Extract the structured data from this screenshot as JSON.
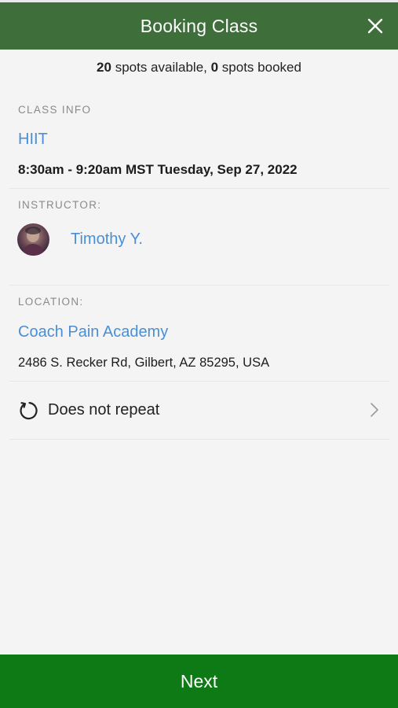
{
  "header": {
    "title": "Booking Class",
    "close_icon": "close-icon"
  },
  "spots": {
    "available_count": "20",
    "available_text": " spots available, ",
    "booked_count": "0",
    "booked_text": " spots booked"
  },
  "class_info": {
    "label": "CLASS INFO",
    "name": "HIIT",
    "time": "8:30am - 9:20am MST Tuesday, Sep 27, 2022"
  },
  "instructor": {
    "label": "INSTRUCTOR:",
    "name": "Timothy Y."
  },
  "location": {
    "label": "LOCATION:",
    "name": "Coach Pain Academy",
    "address": "2486 S. Recker Rd, Gilbert, AZ 85295, USA"
  },
  "repeat": {
    "label": "Does not repeat",
    "icon": "repeat-icon"
  },
  "footer": {
    "next_label": "Next"
  },
  "colors": {
    "header_bg": "#3e6e3a",
    "link": "#4a8fd6",
    "next_bg": "#0d7a16",
    "page_bg": "#f4f4f4"
  }
}
